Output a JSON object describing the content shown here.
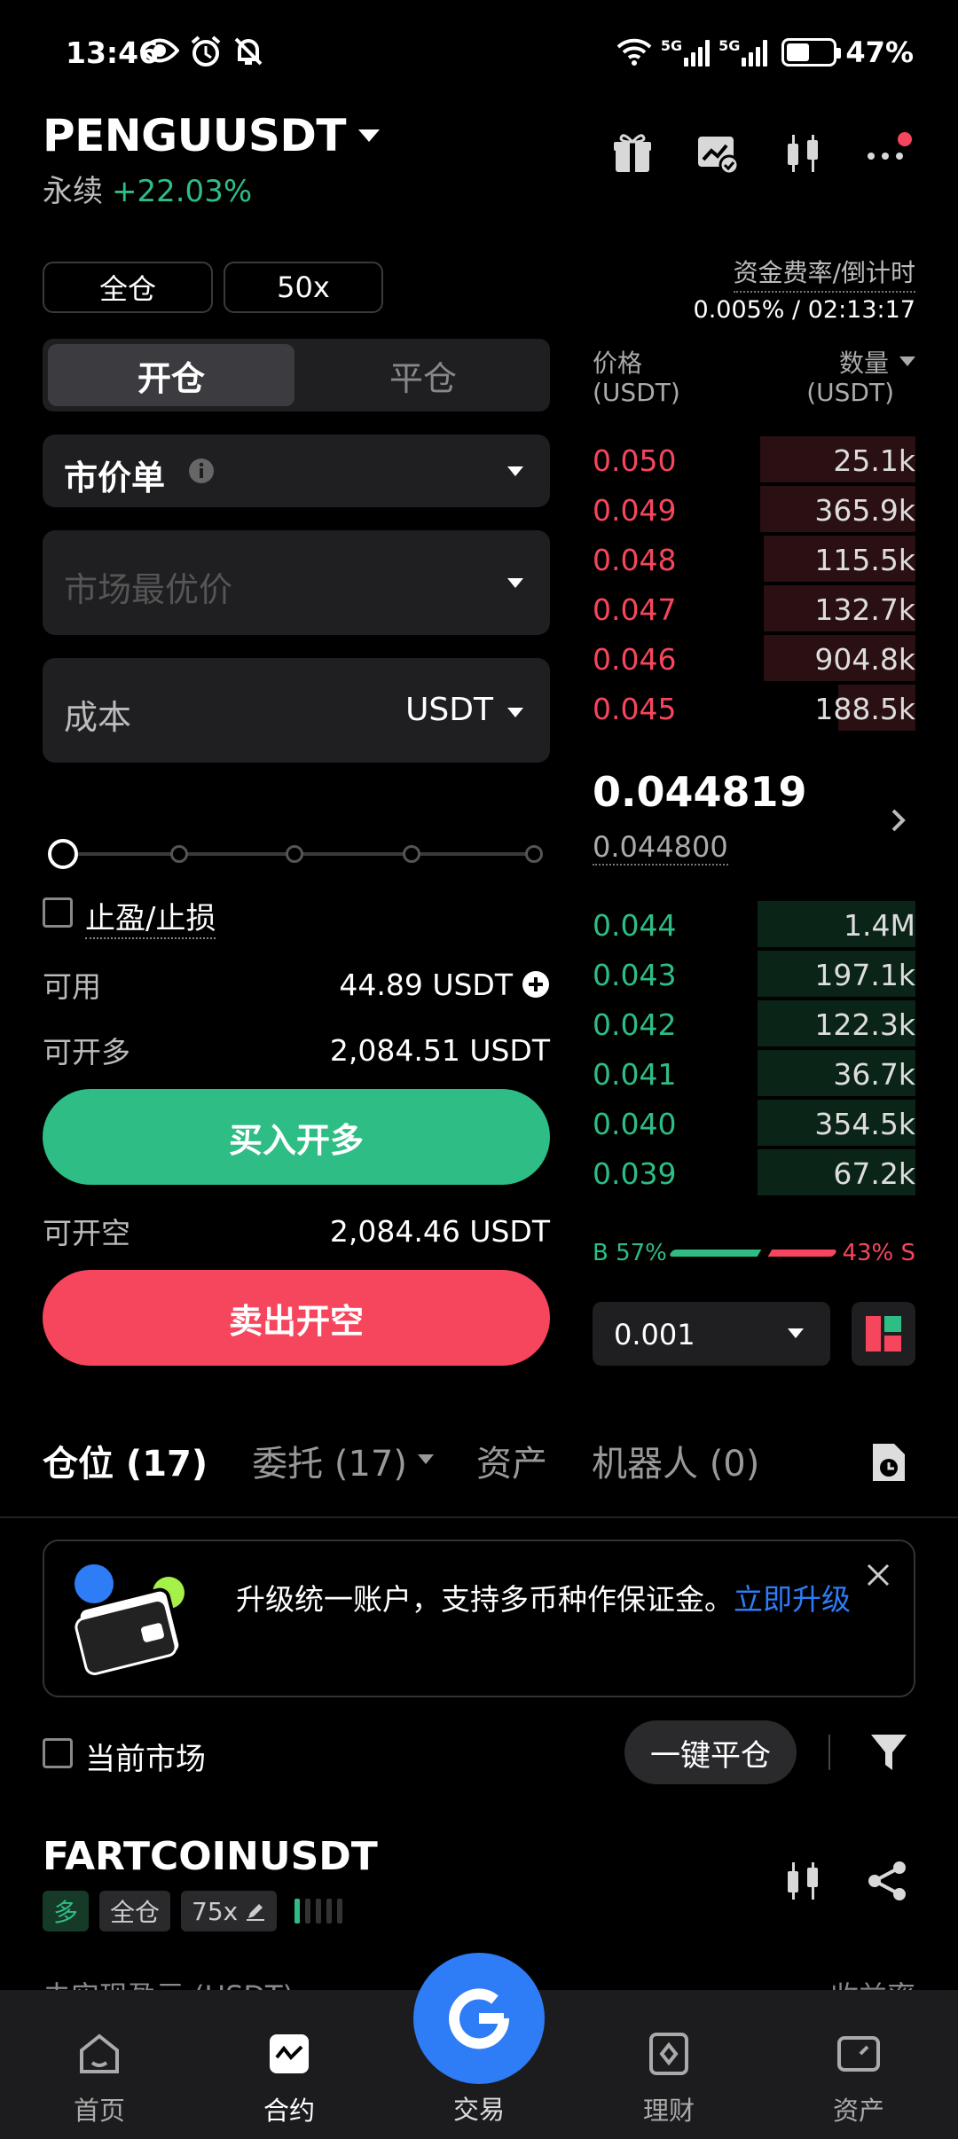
{
  "status_bar": {
    "time": "13:46",
    "battery": "47%",
    "battery_level": 0.47,
    "net1": "5G",
    "net2": "5G"
  },
  "header": {
    "pair": "PENGUUSDT",
    "type": "永续",
    "change": "+22.03%"
  },
  "settings": {
    "margin_mode": "全仓",
    "leverage": "50x",
    "funding_label": "资金费率/倒计时",
    "funding_value": "0.005% / 02:13:17"
  },
  "order_form": {
    "tab_open": "开仓",
    "tab_close": "平仓",
    "order_type": "市价单",
    "price_placeholder": "市场最优价",
    "amount_label": "成本",
    "amount_unit": "USDT",
    "slider_level": 0,
    "tpsl_label": "止盈/止损",
    "available_label": "可用",
    "available_value": "44.89 USDT",
    "max_long_label": "可开多",
    "max_long_value": "2,084.51 USDT",
    "buy_button": "买入开多",
    "max_short_label": "可开空",
    "max_short_value": "2,084.46 USDT",
    "sell_button": "卖出开空"
  },
  "orderbook": {
    "price_header": "价格",
    "price_unit": "(USDT)",
    "qty_header": "数量",
    "qty_unit": "(USDT)",
    "asks": [
      {
        "price": "0.050",
        "qty": "25.1k",
        "depth": 0.48
      },
      {
        "price": "0.049",
        "qty": "365.9k",
        "depth": 0.48
      },
      {
        "price": "0.048",
        "qty": "115.5k",
        "depth": 0.47
      },
      {
        "price": "0.047",
        "qty": "132.7k",
        "depth": 0.47
      },
      {
        "price": "0.046",
        "qty": "904.8k",
        "depth": 0.47
      },
      {
        "price": "0.045",
        "qty": "188.5k",
        "depth": 0.24
      }
    ],
    "last_price": "0.044819",
    "mark_price": "0.044800",
    "bids": [
      {
        "price": "0.044",
        "qty": "1.4M",
        "depth": 0.49
      },
      {
        "price": "0.043",
        "qty": "197.1k",
        "depth": 0.49
      },
      {
        "price": "0.042",
        "qty": "122.3k",
        "depth": 0.49
      },
      {
        "price": "0.041",
        "qty": "36.7k",
        "depth": 0.49
      },
      {
        "price": "0.040",
        "qty": "354.5k",
        "depth": 0.49
      },
      {
        "price": "0.039",
        "qty": "67.2k",
        "depth": 0.49
      }
    ],
    "buy_ratio_label": "B 57%",
    "sell_ratio_label": "43% S",
    "buy_ratio": 0.57,
    "precision": "0.001"
  },
  "bottom_tabs": {
    "positions": "仓位 (17)",
    "orders": "委托 (17)",
    "assets": "资产",
    "bots": "机器人 (0)"
  },
  "banner": {
    "text": "升级统一账户，支持多币种作保证金。",
    "link": "立即升级"
  },
  "filter": {
    "current_market": "当前市场",
    "close_all": "一键平仓"
  },
  "position": {
    "symbol": "FARTCOINUSDT",
    "side": "多",
    "mode": "全仓",
    "leverage": "75x",
    "partial_label": "未实现盈亏 (USDT)",
    "partial_right": "收益率"
  },
  "nav": {
    "home": "首页",
    "futures": "合约",
    "trade": "交易",
    "earn": "理财",
    "assets": "资产"
  },
  "colors": {
    "green": "#2ebd85",
    "red": "#f6465d",
    "blue": "#2e7cf6"
  }
}
